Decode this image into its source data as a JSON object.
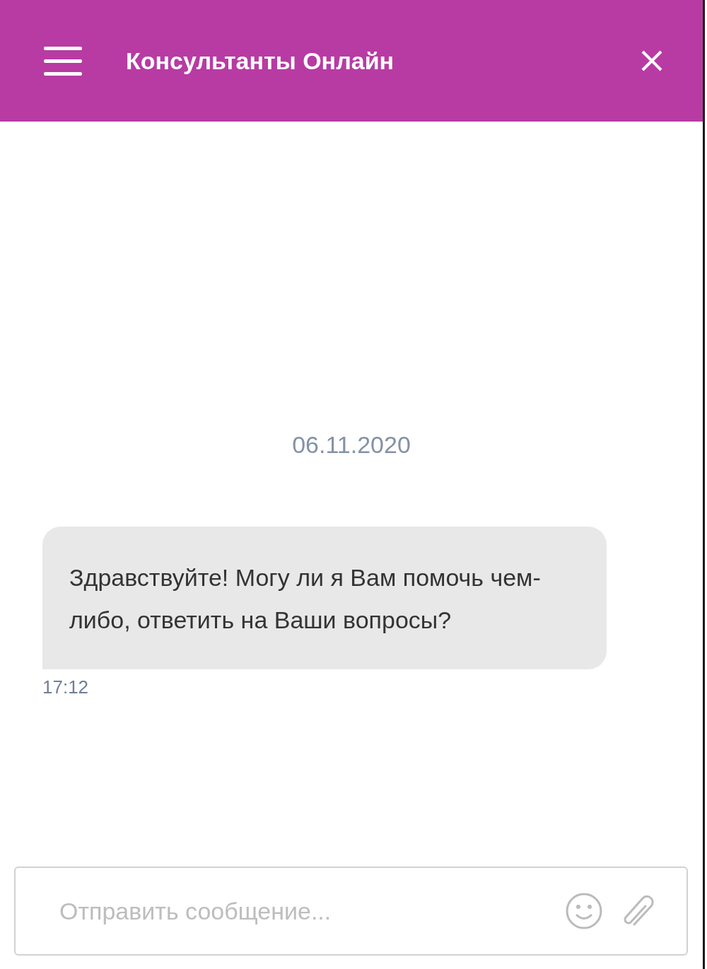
{
  "header": {
    "title": "Консультанты Онлайн"
  },
  "chat": {
    "date": "06.11.2020",
    "messages": [
      {
        "text": "Здравствуйте! Могу ли я Вам помочь чем-либо, ответить на Ваши вопросы?",
        "time": "17:12"
      }
    ]
  },
  "composer": {
    "placeholder": "Отправить сообщение..."
  }
}
